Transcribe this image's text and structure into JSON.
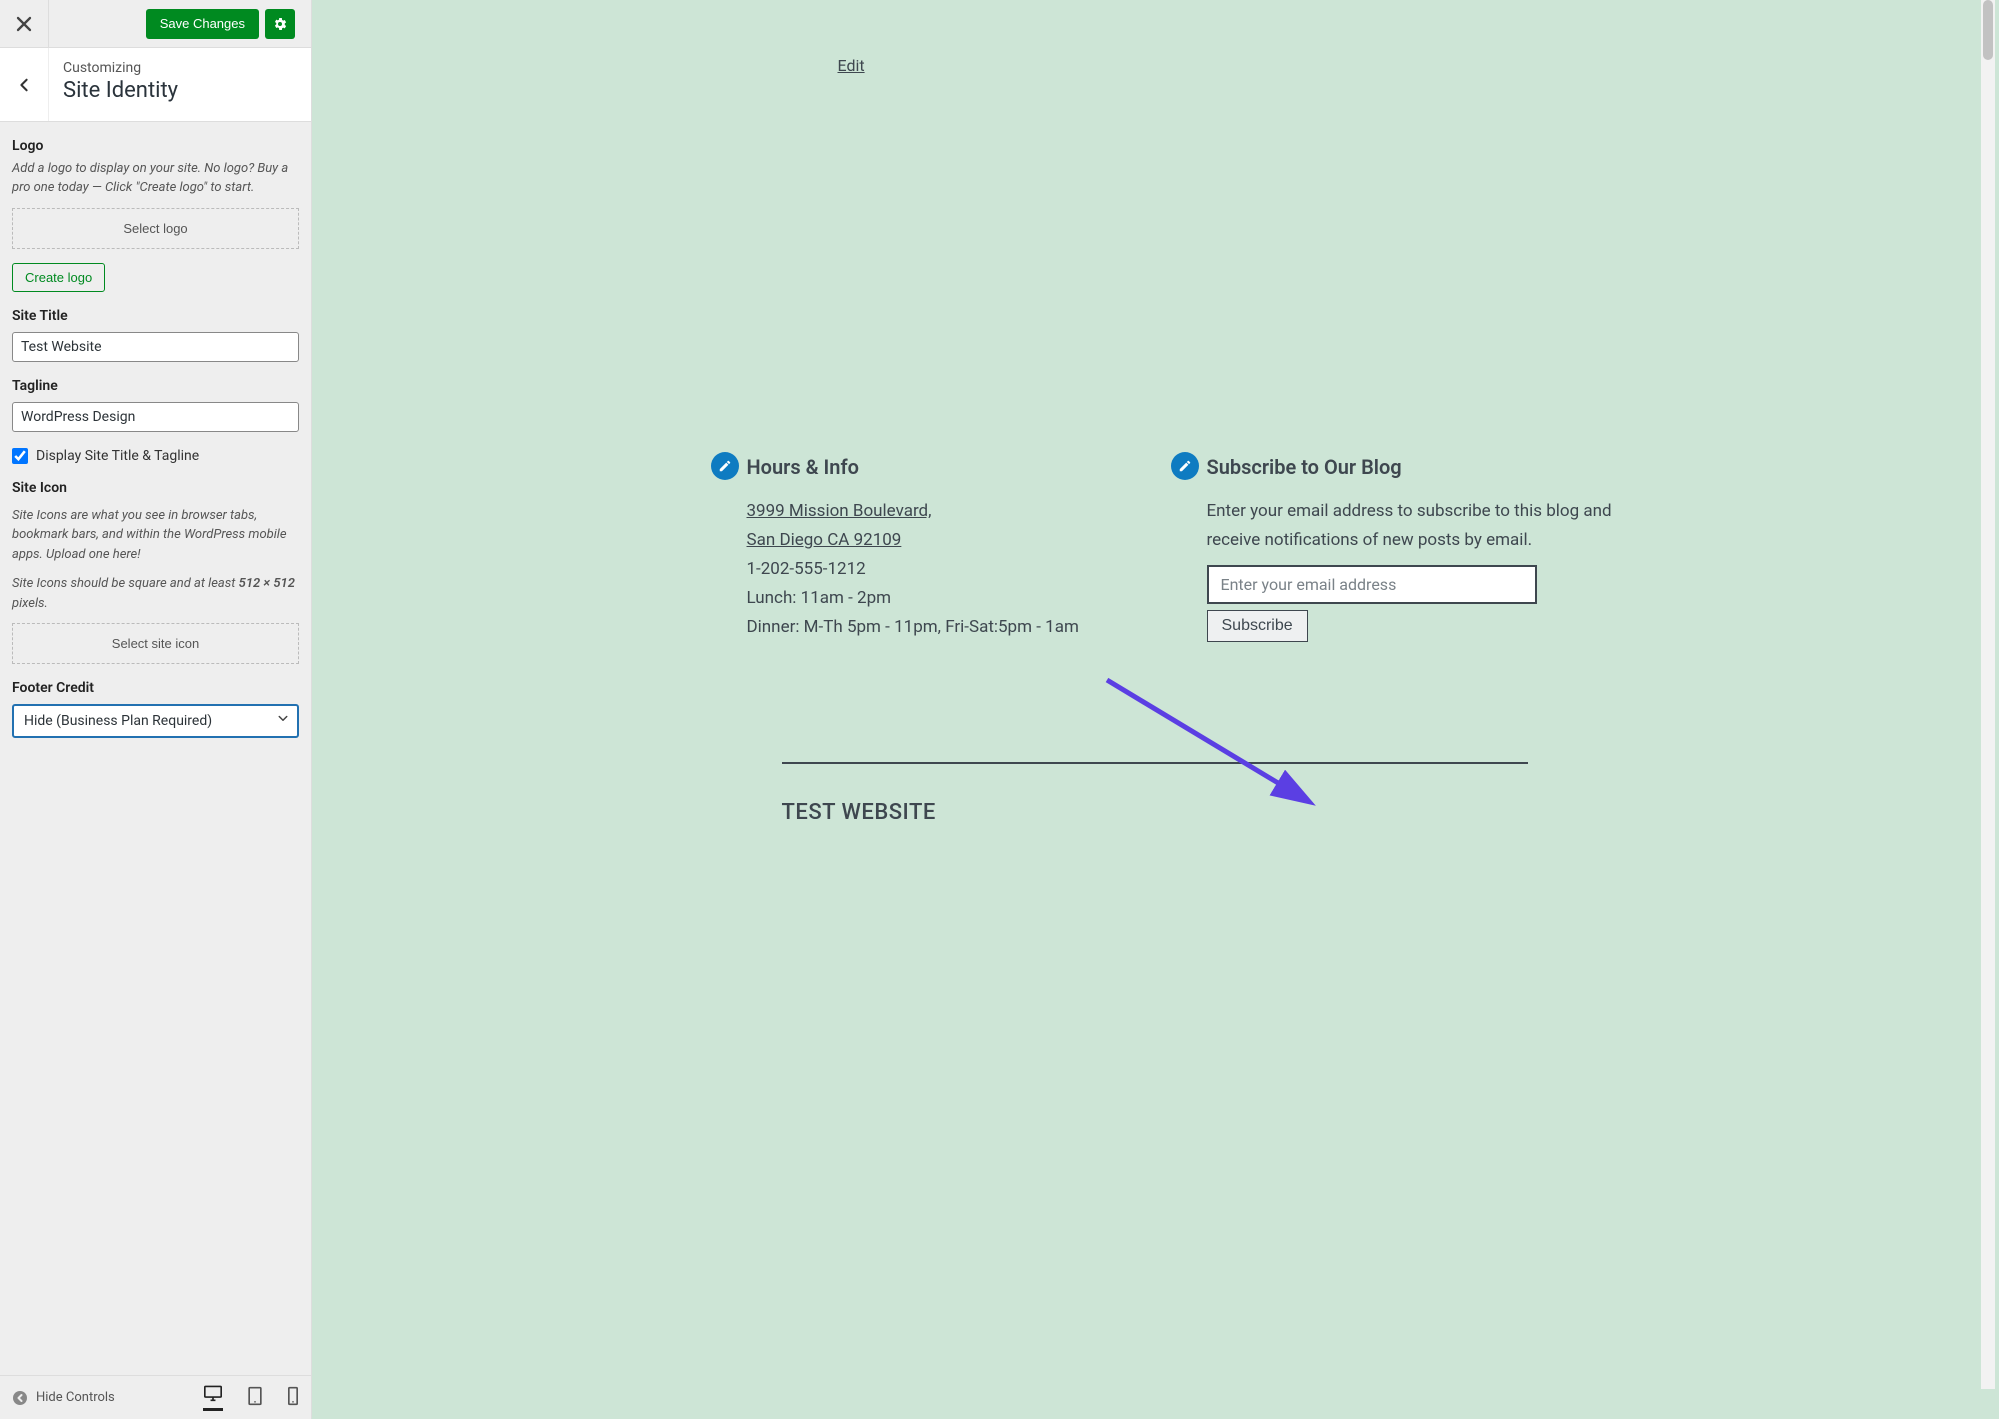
{
  "sidebar": {
    "save_btn": "Save Changes",
    "customizing": "Customizing",
    "section_title": "Site Identity",
    "logo": {
      "label": "Logo",
      "desc": "Add a logo to display on your site. No logo? Buy a pro one today — Click \"Create logo\" to start.",
      "select_btn": "Select logo",
      "create_btn": "Create logo"
    },
    "site_title": {
      "label": "Site Title",
      "value": "Test Website"
    },
    "tagline": {
      "label": "Tagline",
      "value": "WordPress Design"
    },
    "display_check": "Display Site Title & Tagline",
    "site_icon": {
      "label": "Site Icon",
      "desc1": "Site Icons are what you see in browser tabs, bookmark bars, and within the WordPress mobile apps. Upload one here!",
      "desc2_pre": "Site Icons should be square and at least ",
      "desc2_strong": "512 × 512",
      "desc2_post": " pixels.",
      "select_btn": "Select site icon"
    },
    "footer_credit": {
      "label": "Footer Credit",
      "value": "Hide (Business Plan Required)"
    },
    "hide_controls": "Hide Controls"
  },
  "preview": {
    "edit_link": "Edit",
    "hours": {
      "title": "Hours & Info",
      "address_line1": "3999 Mission Boulevard,",
      "address_line2": "San Diego CA 92109",
      "phone": "1-202-555-1212",
      "lunch": "Lunch: 11am - 2pm",
      "dinner": "Dinner: M-Th 5pm - 11pm, Fri-Sat:5pm - 1am"
    },
    "subscribe": {
      "title": "Subscribe to Our Blog",
      "desc": "Enter your email address to subscribe to this blog and receive notifications of new posts by email.",
      "placeholder": "Enter your email address",
      "btn": "Subscribe"
    },
    "footer_site_title": "TEST WEBSITE"
  }
}
